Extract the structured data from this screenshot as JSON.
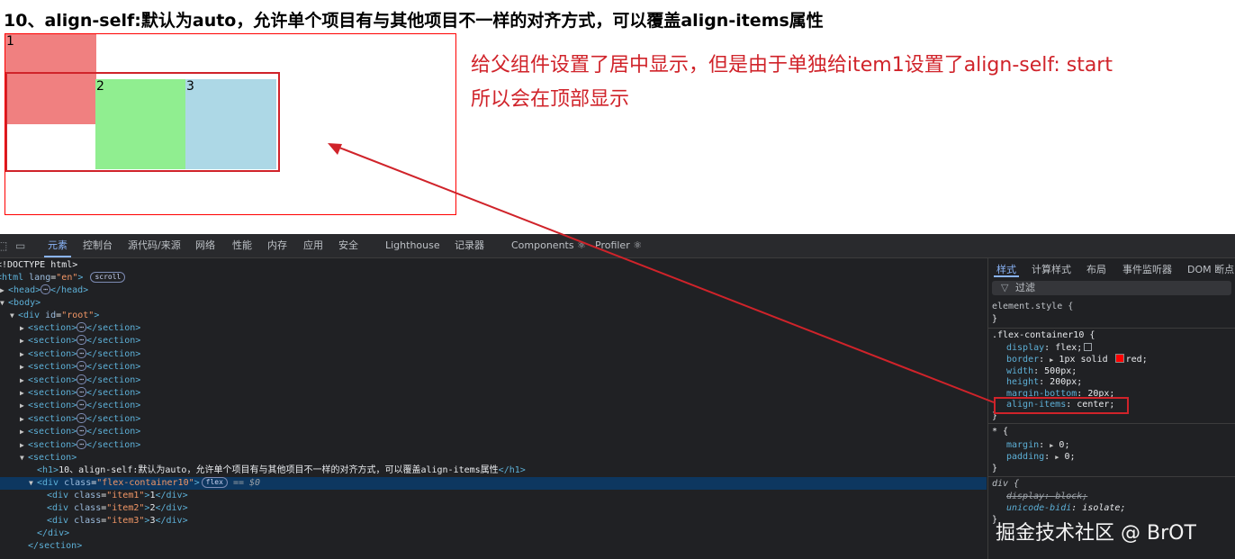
{
  "heading": "10、align-self:默认为auto，允许单个项目有与其他项目不一样的对齐方式，可以覆盖align-items属性",
  "demo": {
    "item1": {
      "label": "1",
      "color": "#f08080"
    },
    "item2": {
      "label": "2",
      "color": "#90ee90"
    },
    "item3": {
      "label": "3",
      "color": "#add8e6"
    },
    "border_color": "#ff0000"
  },
  "annotation": {
    "line1": "给父组件设置了居中显示，但是由于单独给item1设置了align-self: start",
    "line2": "所以会在顶部显示",
    "color": "#d0232a"
  },
  "devtools": {
    "tabs": [
      "元素",
      "控制台",
      "源代码/来源",
      "网络",
      "性能",
      "内存",
      "应用",
      "安全",
      "Lighthouse",
      "记录器",
      "Components ⚛",
      "Profiler ⚛"
    ],
    "toolbar_icons": [
      "inspect-icon",
      "device-toggle-icon"
    ],
    "dom": {
      "doctype": "<!DOCTYPE html>",
      "html_tag": "html",
      "html_attr": "lang",
      "html_attr_value": "\"en\"",
      "scroll_badge": "scroll",
      "head_tag": "head",
      "body_tag": "body",
      "root_attr": "id",
      "root_value": "\"root\"",
      "section_tag": "section",
      "h1_text": "10、align-self:默认为auto，允许单个项目有与其他项目不一样的对齐方式，可以覆盖align-items属性",
      "container_class": "\"flex-container10\"",
      "flex_badge": "flex",
      "eq_dollar": "== $0",
      "children": [
        {
          "class": "\"item1\"",
          "text": "1"
        },
        {
          "class": "\"item2\"",
          "text": "2"
        },
        {
          "class": "\"item3\"",
          "text": "3"
        }
      ]
    },
    "styles": {
      "tabs": [
        "样式",
        "计算样式",
        "布局",
        "事件监听器",
        "DOM 断点"
      ],
      "filter_placeholder": "过滤",
      "element_style": "element.style {",
      "rule_selector": ".flex-container10 {",
      "props": [
        {
          "name": "display",
          "value": "flex;"
        },
        {
          "name": "border",
          "value": "1px solid"
        },
        {
          "name": "width",
          "value": "500px;"
        },
        {
          "name": "height",
          "value": "200px;"
        },
        {
          "name": "margin-bottom",
          "value": "20px;"
        },
        {
          "name": "align-items",
          "value": "center;"
        }
      ],
      "border_color_word": "red;",
      "star_selector": "* {",
      "star_props": [
        {
          "name": "margin",
          "value": "0;"
        },
        {
          "name": "padding",
          "value": "0;"
        }
      ],
      "ua_selector": "div {",
      "ua_props": [
        {
          "name": "display",
          "value": "block;"
        },
        {
          "name": "unicode-bidi",
          "value": "isolate;"
        }
      ],
      "close_brace": "}"
    }
  },
  "watermark": "掘金技术社区 @ BrOT"
}
